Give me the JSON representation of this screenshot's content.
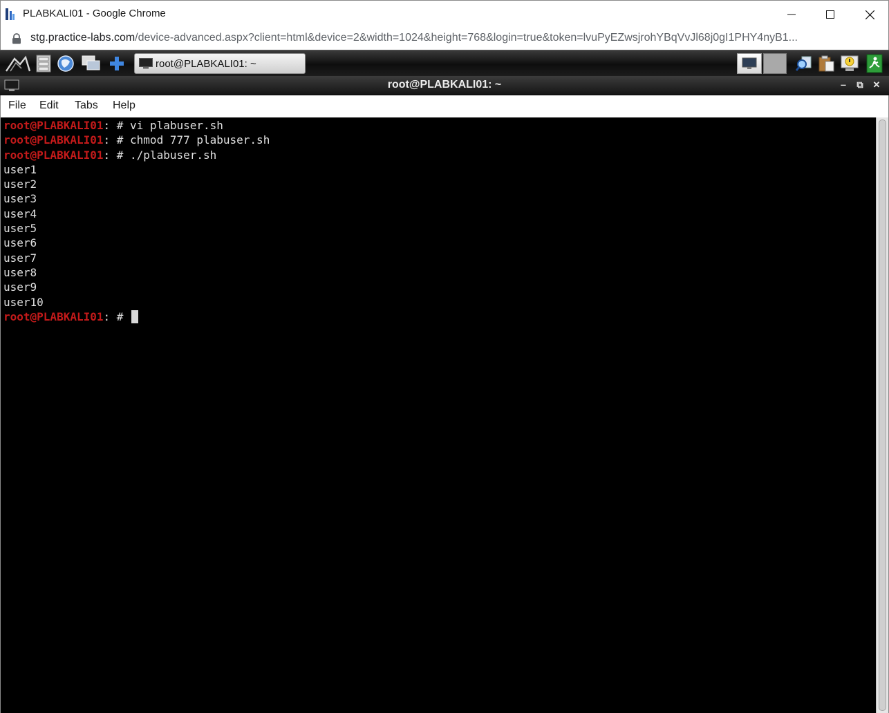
{
  "browser": {
    "title": "PLABKALI01 - Google Chrome",
    "url_host": "stg.practice-labs.com",
    "url_path": "/device-advanced.aspx?client=html&device=2&width=1024&height=768&login=true&token=lvuPyEZwsjrohYBqVvJl68j0gI1PHY4nyB1..."
  },
  "desktop_panel": {
    "task_label": "root@PLABKALI01: ~"
  },
  "terminal": {
    "title": "root@PLABKALI01: ~",
    "menu": [
      "File",
      "Edit",
      "Tabs",
      "Help"
    ],
    "prompt_user": "root@PLABKALI01",
    "prompt_sep": ": # ",
    "commands": [
      "vi plabuser.sh",
      "chmod 777 plabuser.sh",
      "./plabuser.sh"
    ],
    "output": [
      "user1",
      "user2",
      "user3",
      "user4",
      "user5",
      "user6",
      "user7",
      "user8",
      "user9",
      "user10"
    ]
  },
  "colors": {
    "prompt": "#c41a1a",
    "terminal_bg": "#000000",
    "terminal_fg": "#e0e0e0"
  }
}
